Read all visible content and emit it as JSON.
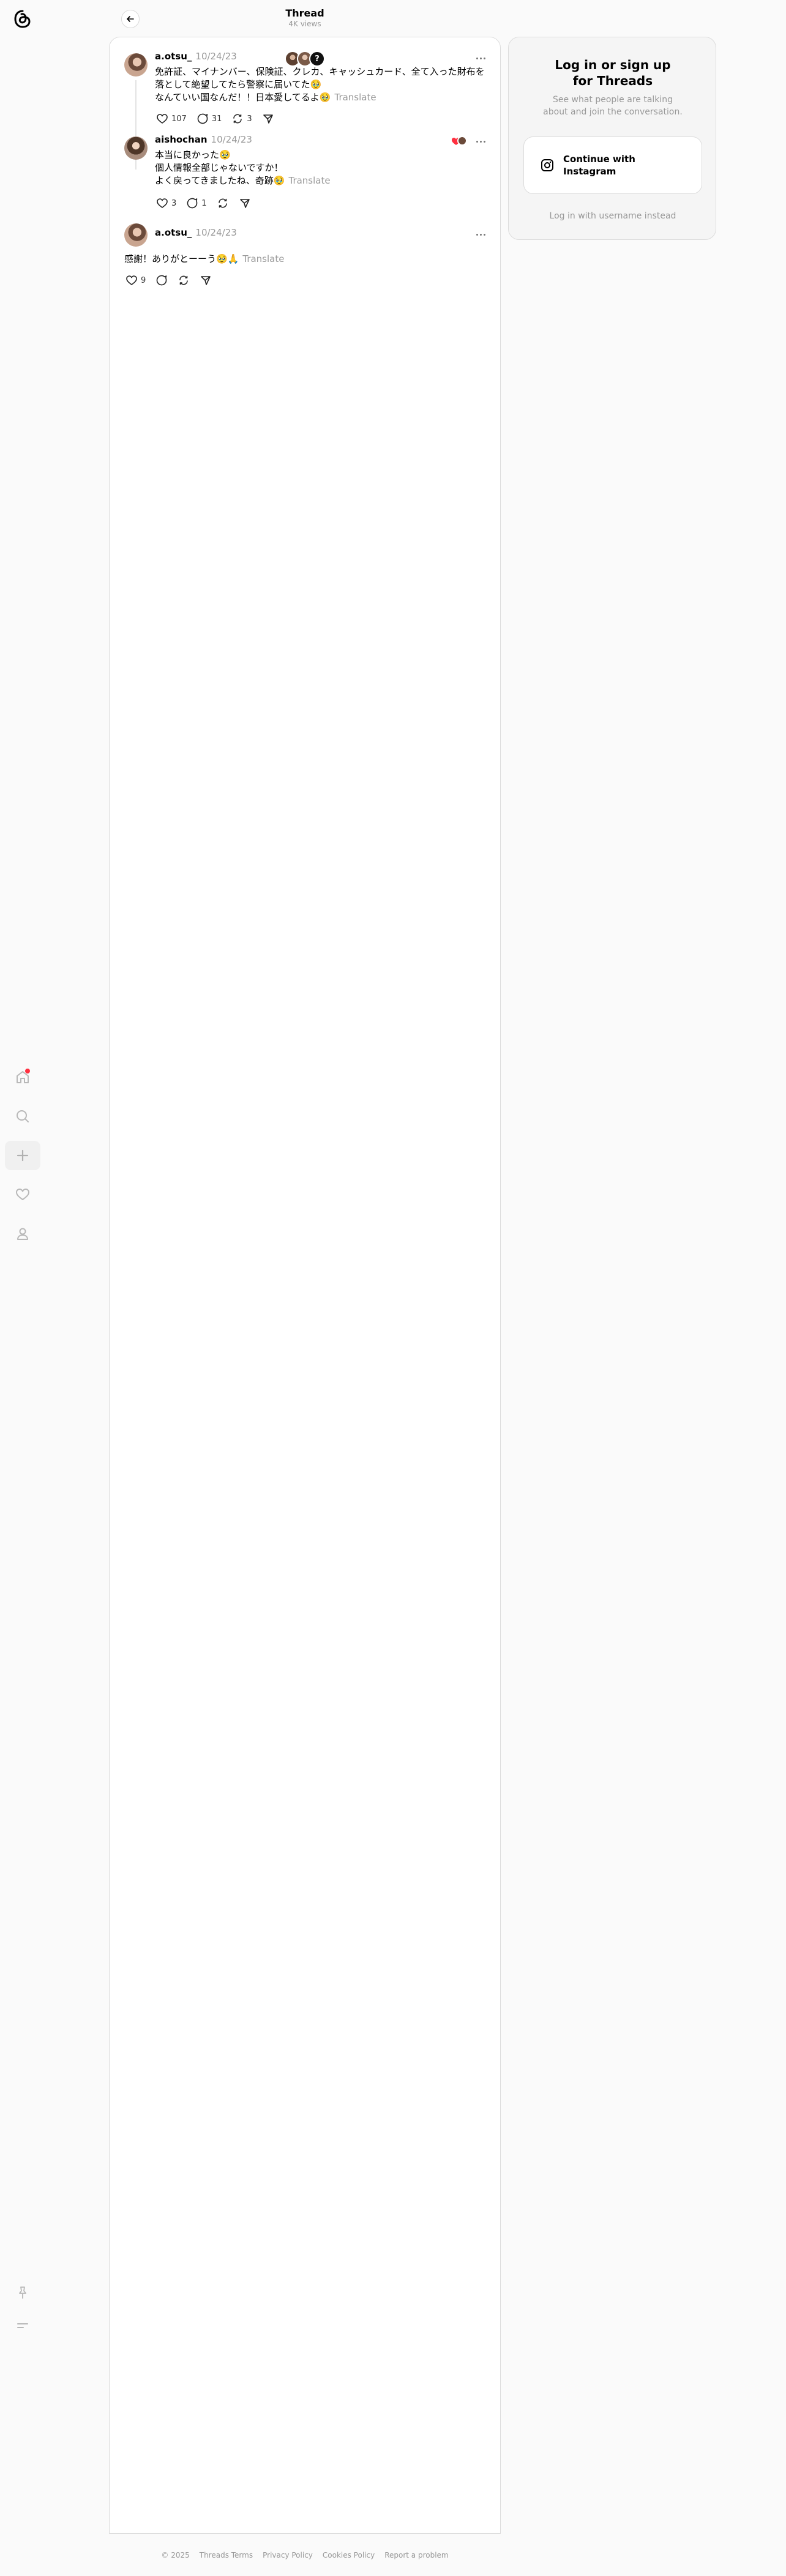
{
  "header": {
    "title": "Thread",
    "subtitle": "4K views"
  },
  "posts": [
    {
      "username": "a.otsu_",
      "date": "10/24/23",
      "lines": [
        "免許証、マイナンバー、保険証、クレカ、キャッシュカード、全て入った財布を",
        "落として絶望してたら警察に届いてた🥹",
        "なんていい国なんだ！！日本愛してるよ🥹"
      ],
      "translate": "Translate",
      "likes": "107",
      "replies": "31",
      "reposts": "3"
    },
    {
      "username": "aishochan",
      "date": "10/24/23",
      "lines": [
        "本当に良かった🥹",
        "個人情報全部じゃないですか！",
        "よく戻ってきましたね、奇跡🥹"
      ],
      "translate": "Translate",
      "likes": "3",
      "replies": "1",
      "reposts": ""
    },
    {
      "username": "a.otsu_",
      "date": "10/24/23",
      "lines": [
        "感謝！ありがとーーう🥹🙏"
      ],
      "translate": "Translate",
      "likes": "9",
      "replies": "",
      "reposts": ""
    }
  ],
  "reply_avatars": {
    "count_badge": "?"
  },
  "login": {
    "title": "Log in or sign up for Threads",
    "subtitle": "See what people are talking about and join the conversation.",
    "instagram_button": "Continue with Instagram",
    "username_link": "Log in with username instead"
  },
  "footer": {
    "links": [
      "© 2025",
      "Threads Terms",
      "Privacy Policy",
      "Cookies Policy",
      "Report a problem"
    ]
  },
  "colors": {
    "accent_notification": "#ff3040",
    "muted_text": "#999999",
    "heart_badge": "#ff3040"
  },
  "icons": [
    "threads-logo-icon",
    "home-icon",
    "search-icon",
    "plus-icon",
    "heart-icon",
    "profile-icon",
    "pin-icon",
    "menu-icon",
    "back-arrow-icon",
    "more-icon",
    "reply-icon",
    "repost-icon",
    "share-icon",
    "instagram-icon"
  ]
}
